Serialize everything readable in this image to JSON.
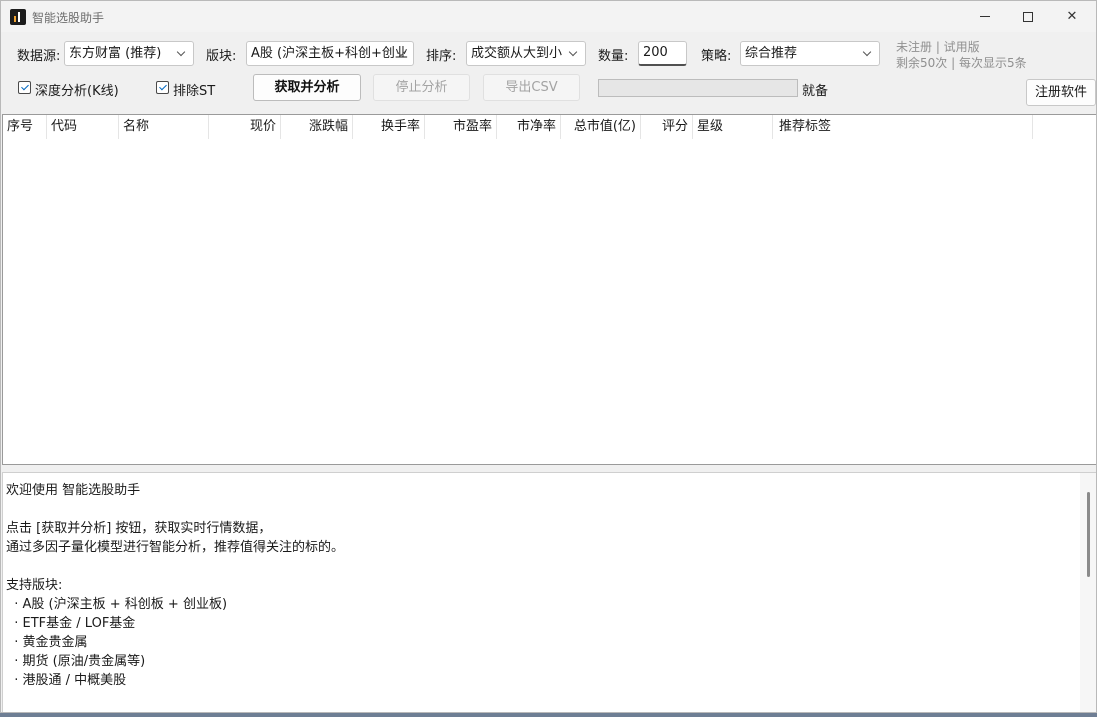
{
  "window": {
    "title": "智能选股助手"
  },
  "toolbar": {
    "source_label": "数据源:",
    "source_value": "东方财富 (推荐)",
    "board_label": "版块:",
    "board_value": "A股 (沪深主板+科创+创业",
    "sort_label": "排序:",
    "sort_value": "成交额从大到小",
    "qty_label": "数量:",
    "qty_value": "200",
    "strategy_label": "策略:",
    "strategy_value": "综合推荐",
    "reg_status": "未注册 | 试用版",
    "reg_remaining": "剩余50次 | 每次显示5条",
    "deep_label": "深度分析(K线)",
    "exclude_st_label": "排除ST",
    "fetch_label": "获取并分析",
    "stop_label": "停止分析",
    "export_label": "导出CSV",
    "status_text": "就备",
    "progress": 0,
    "register_label": "注册软件"
  },
  "table": {
    "columns": [
      "序号",
      "代码",
      "名称",
      "现价",
      "涨跌幅",
      "换手率",
      "市盈率",
      "市净率",
      "总市值(亿)",
      "评分",
      "星级",
      "推荐标签"
    ],
    "rows": []
  },
  "log": {
    "lines": [
      "欢迎使用 智能选股助手",
      "",
      "点击 [获取并分析] 按钮，获取实时行情数据，",
      "通过多因子量化模型进行智能分析，推荐值得关注的标的。",
      "",
      "支持版块:",
      "  · A股 (沪深主板 + 科创板 + 创业板)",
      "  · ETF基金 / LOF基金",
      "  · 黄金贵金属",
      "  · 期货 (原油/贵金属等)",
      "  · 港股通 / 中概美股"
    ]
  },
  "colors": {
    "checkbox": "#0067c0",
    "progress_fill": "#06b025"
  }
}
